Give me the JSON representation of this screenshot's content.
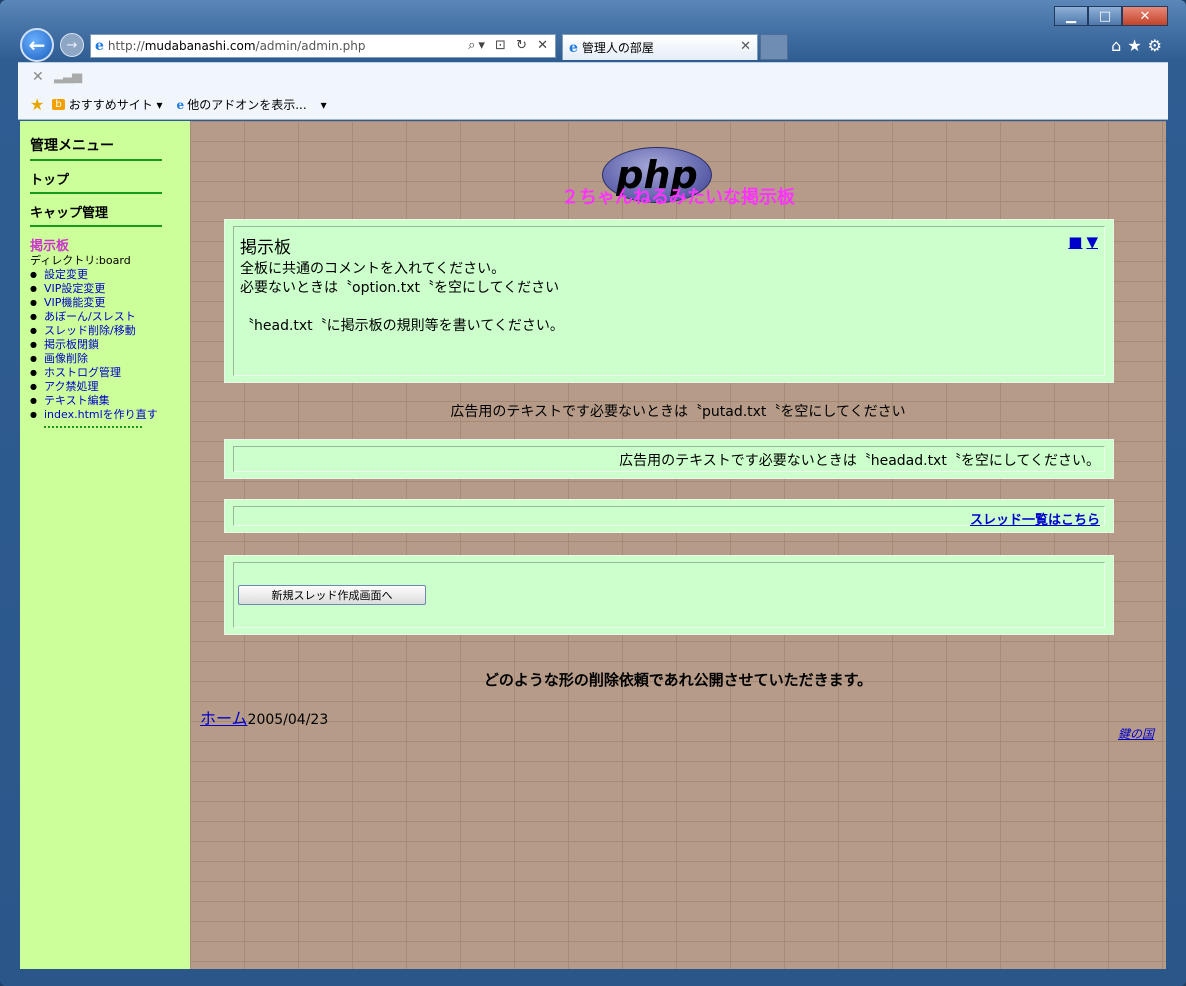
{
  "browser": {
    "url_prefix": "http://",
    "url_domain": "mudabanashi.com",
    "url_path": "/admin/admin.php",
    "address_tools": "⌕▾ ⊡ ↻ ✕",
    "tab_title": "管理人の部屋",
    "tab_close": "✕",
    "toolbar_stop": "✕",
    "favorites": {
      "suggested_sites": "おすすめサイト ▾",
      "addons": "他のアドオンを表示...",
      "more": "▾"
    },
    "window_buttons": {
      "minimize": "▁",
      "maximize": "□",
      "close": "✕"
    },
    "right_icons": "⌂★⚙"
  },
  "sidebar": {
    "admin_menu": "管理メニュー",
    "top": "トップ",
    "cap_admin": "キャップ管理",
    "board": "掲示板",
    "directory": "ディレクトリ:board",
    "items": [
      "設定変更",
      "VIP設定変更",
      "VIP機能変更",
      "あぼーん/スレスト",
      "スレッド削除/移動",
      "掲示板閉鎖",
      "画像削除",
      "ホストログ管理",
      "アク禁処理",
      "テキスト編集",
      "index.htmlを作り直す"
    ]
  },
  "main": {
    "logo_text": "php",
    "site_title": "２ちゃんねるみたいな掲示板",
    "board_panel": {
      "heading": "掲示板",
      "nav_marks": [
        "■",
        "▼"
      ],
      "lines": [
        "全板に共通のコメントを入れてください。",
        "必要ないときは〝option.txt〝を空にしてください",
        "",
        "〝head.txt〝に掲示板の規則等を書いてください。"
      ]
    },
    "ad_text_1": "広告用のテキストです必要ないときは〝putad.txt〝を空にしてください",
    "ad_text_2": "広告用のテキストです必要ないときは〝headad.txt〝を空にしてください。",
    "thread_list_link": "スレッド一覧はこちら",
    "new_thread_button": "新規スレッド作成画面へ",
    "notice": "どのような形の削除依頼であれ公開させていただきます。",
    "home_link": "ホーム",
    "date": "2005/04/23",
    "footer_link": "鍵の国"
  }
}
